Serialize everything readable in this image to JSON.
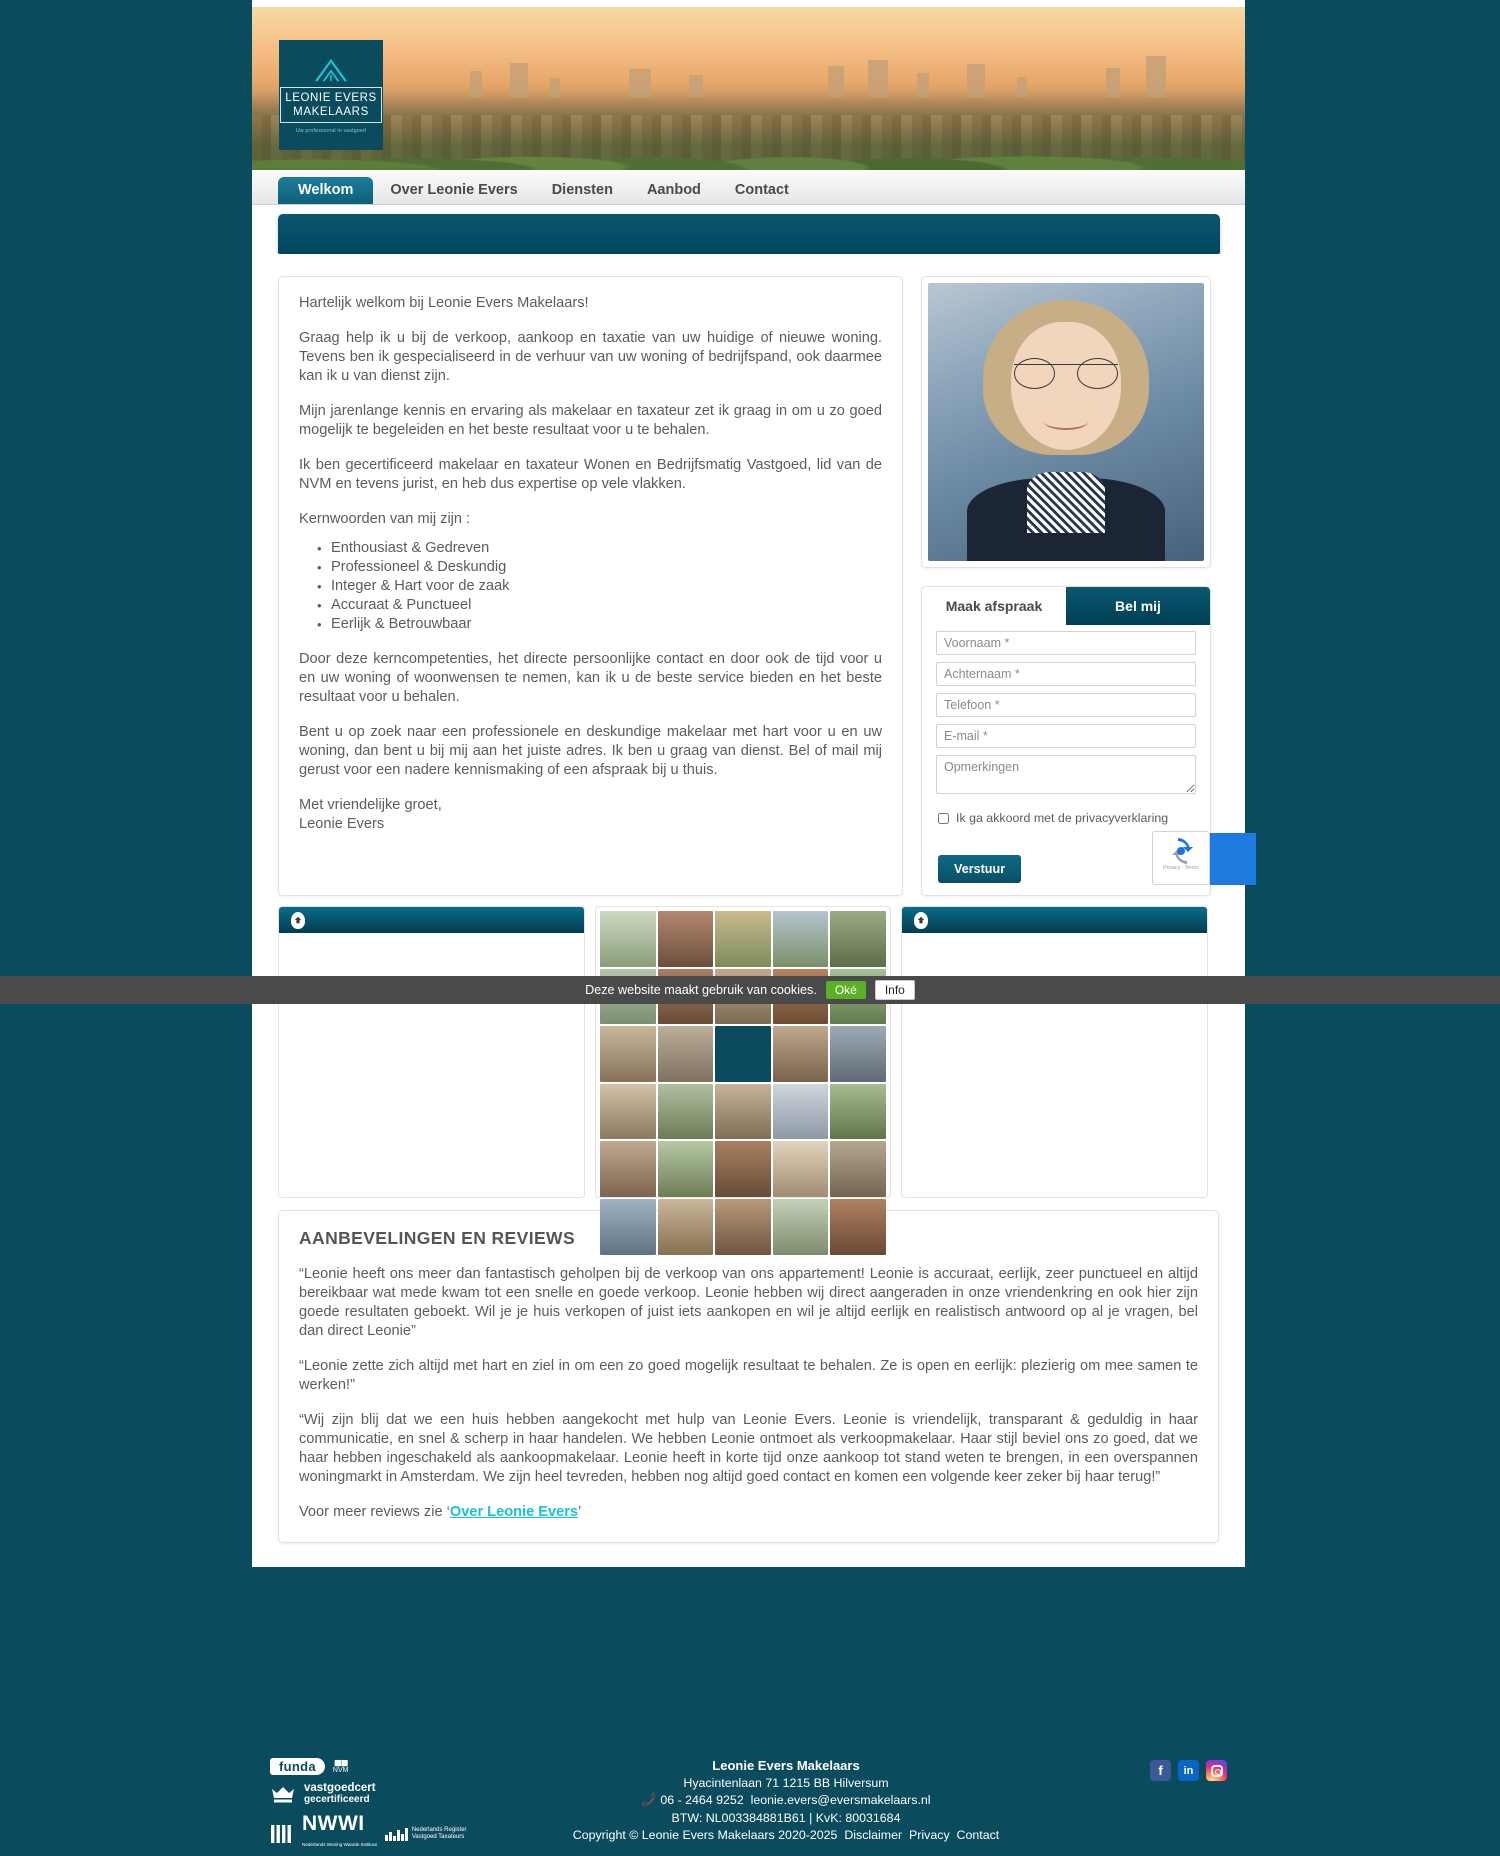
{
  "brand": {
    "logo_line1": "LEONIE EVERS",
    "logo_line2": "MAKELAARS",
    "logo_tagline": "Uw professional in vastgoed",
    "accent": "#0b4b5e",
    "link_accent": "#19c2d4"
  },
  "nav": {
    "items": [
      {
        "label": "Welkom",
        "active": true
      },
      {
        "label": "Over Leonie Evers",
        "active": false
      },
      {
        "label": "Diensten",
        "active": false
      },
      {
        "label": "Aanbod",
        "active": false
      },
      {
        "label": "Contact",
        "active": false
      }
    ]
  },
  "main": {
    "greeting": "Hartelijk welkom bij Leonie Evers Makelaars!",
    "p1": "Graag help ik u bij de verkoop, aankoop en taxatie van uw huidige of nieuwe woning. Tevens ben ik gespecialiseerd in de verhuur van uw woning of bedrijfspand, ook daarmee kan ik u van dienst zijn.",
    "p2": "Mijn jarenlange kennis en ervaring als makelaar en taxateur zet ik graag in om u zo goed mogelijk te begeleiden en het beste resultaat voor u te behalen.",
    "p3": "Ik ben gecertificeerd makelaar en taxateur Wonen en Bedrijfsmatig Vastgoed, lid van de NVM en tevens jurist, en heb dus expertise op vele vlakken.",
    "keywords_intro": "Kernwoorden van mij zijn :",
    "keywords": [
      "Enthousiast & Gedreven",
      "Professioneel & Deskundig",
      "Integer & Hart voor de zaak",
      "Accuraat & Punctueel",
      "Eerlijk & Betrouwbaar"
    ],
    "p4": "Door deze kerncompetenties, het directe persoonlijke contact en door ook de tijd voor u en uw woning of woonwensen te nemen, kan ik u de beste service bieden en het beste resultaat voor u behalen.",
    "p5": "Bent u op zoek naar een professionele en deskundige makelaar met hart voor u en uw woning, dan bent u bij mij aan het juiste adres. Ik ben u graag van dienst. Bel of mail mij gerust voor een nadere kennismaking of een afspraak bij u thuis.",
    "signoff_line1": "Met vriendelijke groet,",
    "signoff_line2": "Leonie Evers"
  },
  "form": {
    "tab_appointment": "Maak afspraak",
    "tab_callme": "Bel mij",
    "fields": [
      {
        "name": "voornaam",
        "placeholder": "Voornaam *",
        "value": ""
      },
      {
        "name": "achternaam",
        "placeholder": "Achternaam *",
        "value": ""
      },
      {
        "name": "telefoon",
        "placeholder": "Telefoon *",
        "value": ""
      },
      {
        "name": "email",
        "placeholder": "E-mail *",
        "value": ""
      }
    ],
    "textarea_placeholder": "Opmerkingen",
    "consent_label": "Ik ga akkoord met de privacyverklaring",
    "consent_checked": false,
    "submit_label": "Verstuur",
    "recaptcha_label": "Privacy - Terms"
  },
  "cookies": {
    "message": "Deze website maakt gebruik van cookies.",
    "ok_label": "Oké",
    "info_label": "Info"
  },
  "reviews": {
    "title": "AANBEVELINGEN EN REVIEWS",
    "items": [
      "“Leonie heeft ons meer dan fantastisch geholpen bij de verkoop van ons appartement! Leonie is accuraat, eerlijk, zeer punctueel en altijd bereikbaar wat mede kwam tot een snelle en goede verkoop. Leonie hebben wij direct aangeraden in onze vriendenkring en ook hier zijn goede resultaten geboekt. Wil je je huis verkopen of juist iets aankopen en wil je altijd eerlijk en realistisch antwoord op al je vragen, bel dan direct Leonie”",
      "“Leonie zette zich altijd met hart en ziel in om een zo goed mogelijk resultaat te behalen. Ze is open en eerlijk: plezierig om mee samen te werken!”",
      "“Wij zijn blij dat we een huis hebben aangekocht met hulp van Leonie Evers. Leonie is vriendelijk, transparant & geduldig in haar communicatie, en snel & scherp in haar handelen. We hebben Leonie ontmoet als verkoopmakelaar. Haar stijl beviel ons zo goed, dat we haar hebben ingeschakeld als aankoopmakelaar. Leonie heeft in korte tijd onze aankoop tot stand weten te brengen, in een overspannen woningmarkt in Amsterdam. We zijn heel tevreden, hebben nog altijd goed contact en komen een volgende keer zeker bij haar terug!”"
    ],
    "more_prefix": "Voor meer reviews zie ‘",
    "more_link": "Over Leonie Evers",
    "more_suffix": "’"
  },
  "footer": {
    "company": "Leonie Evers Makelaars",
    "address": "Hyacintenlaan 71   1215 BB Hilversum",
    "phone": "06 - 2464 9252",
    "email": "leonie.evers@eversmakelaars.nl",
    "registration": "BTW: NL003384881B61 | KvK: 80031684",
    "copyright": "Copyright © Leonie Evers Makelaars 2020-2025",
    "link_disclaimer": "Disclaimer",
    "link_privacy": "Privacy",
    "link_contact": "Contact",
    "badges": {
      "funda": "funda",
      "nvm": "NVM",
      "vastgoedcert_l1": "vastgoedcert",
      "vastgoedcert_l2": "gecertificeerd",
      "nwwi": "NWWI",
      "nwwi_sub": "Nederlands Woning Waarde Instituut",
      "nrvt_l1": "Nederlands Register",
      "nrvt_l2": "Vastgoed Taxateurs"
    },
    "social": [
      {
        "name": "facebook",
        "glyph": "f"
      },
      {
        "name": "linkedin",
        "glyph": "in"
      },
      {
        "name": "instagram",
        "glyph": ""
      }
    ]
  }
}
